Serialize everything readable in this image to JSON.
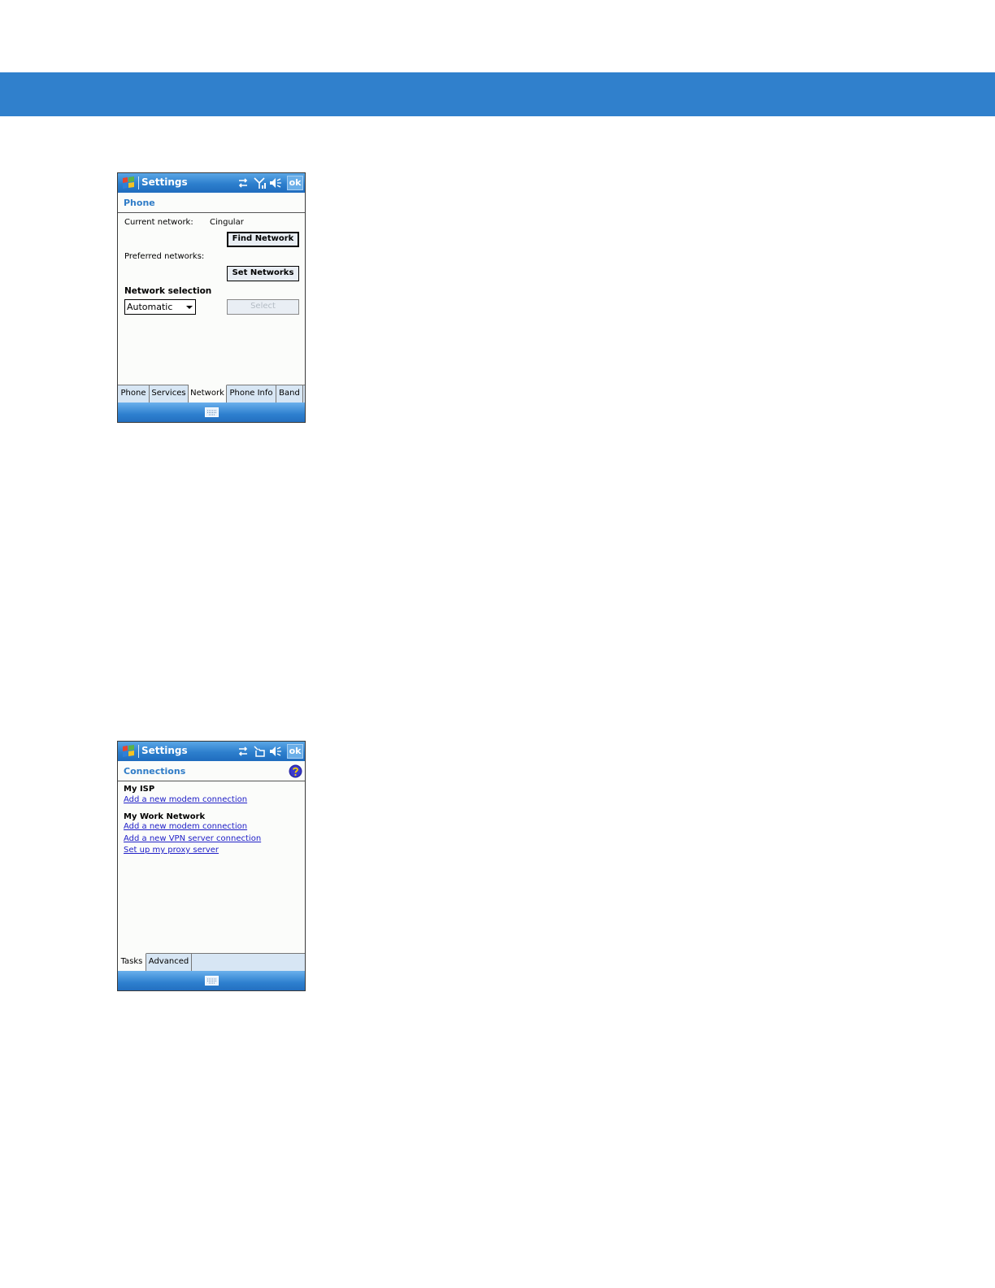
{
  "banner_color": "#3080cc",
  "screens": [
    {
      "title": "Settings",
      "ok_label": "ok",
      "header": "Phone",
      "current_network_label": "Current network:",
      "current_network_value": "Cingular",
      "find_network_label": "Find Network",
      "preferred_networks_label": "Preferred networks:",
      "set_networks_label": "Set Networks",
      "network_selection_heading": "Network selection",
      "network_selection_value": "Automatic",
      "select_label": "Select",
      "tabs": [
        "Phone",
        "Services",
        "Network",
        "Phone Info",
        "Band"
      ],
      "active_tab": "Network"
    },
    {
      "title": "Settings",
      "ok_label": "ok",
      "header": "Connections",
      "groups": [
        {
          "title": "My ISP",
          "links": [
            "Add a new modem connection"
          ]
        },
        {
          "title": "My Work Network",
          "links": [
            "Add a new modem connection",
            "Add a new VPN server connection",
            "Set up my proxy server"
          ]
        }
      ],
      "tabs": [
        "Tasks",
        "Advanced"
      ],
      "active_tab": "Tasks"
    }
  ],
  "icons": [
    "windows-start-icon",
    "connectivity-icon",
    "signal-icon",
    "no-signal-icon",
    "speaker-icon",
    "help-icon",
    "keyboard-icon"
  ]
}
